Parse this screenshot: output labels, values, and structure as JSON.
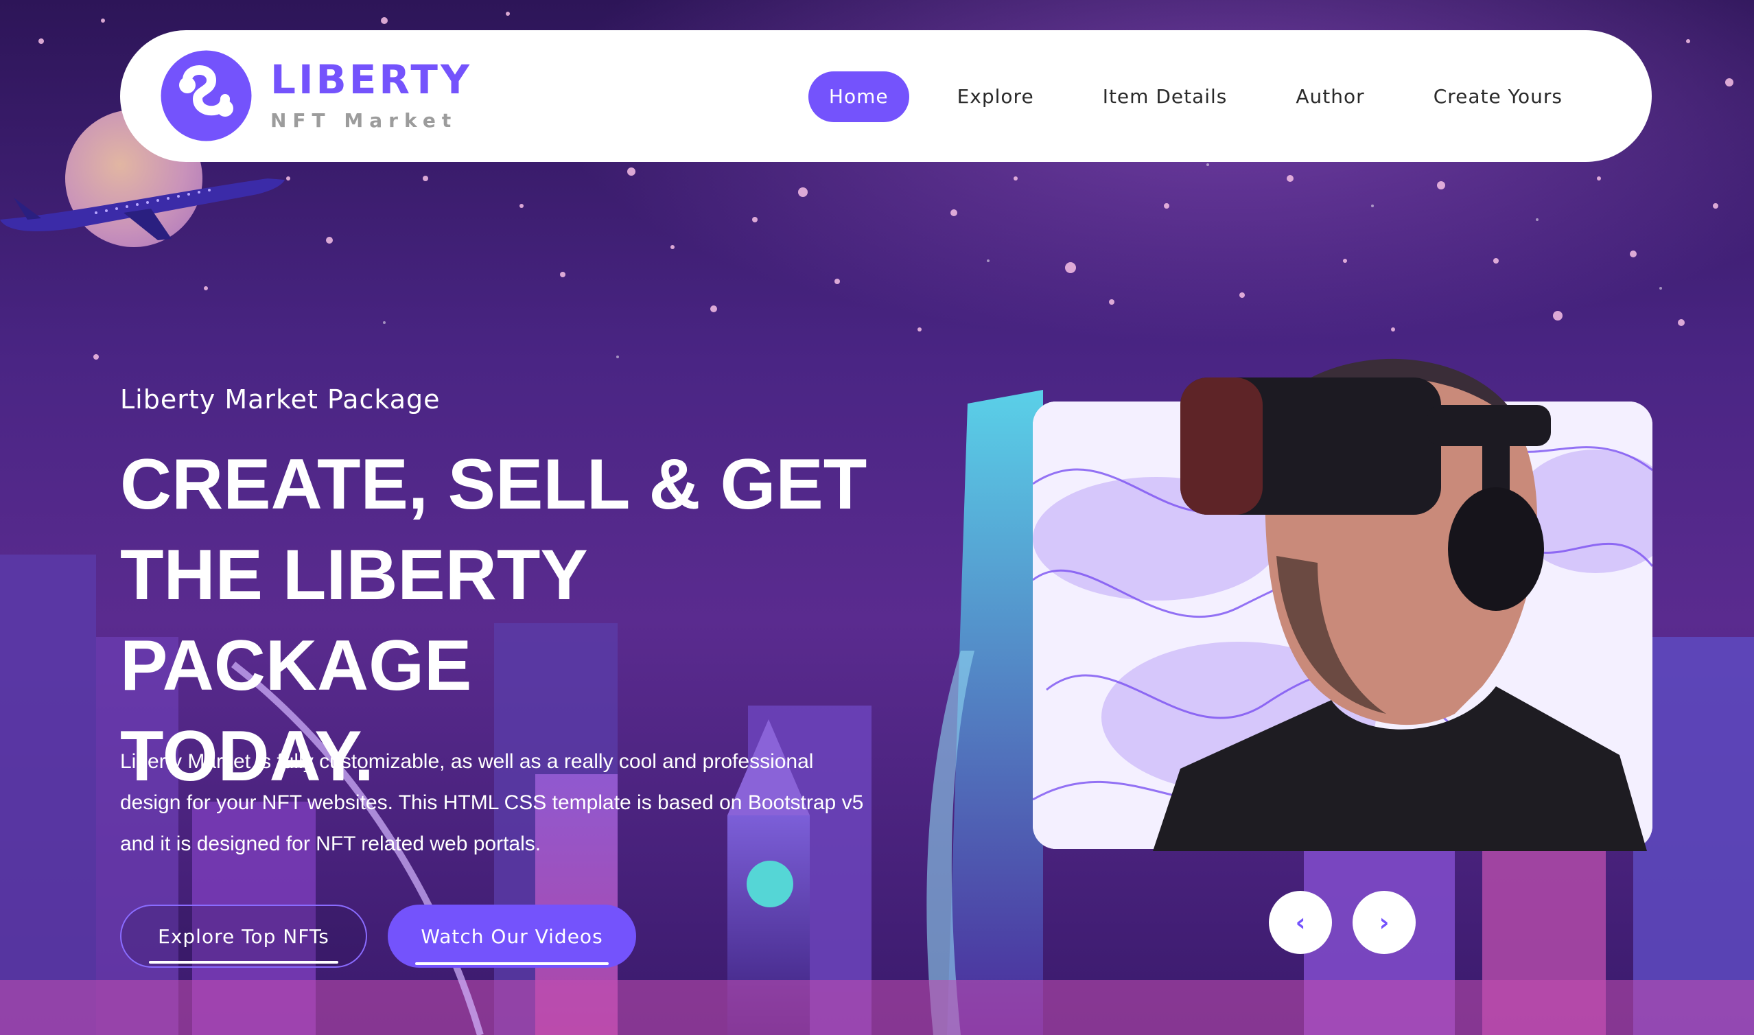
{
  "brand": {
    "name": "LIBERTY",
    "tagline": "NFT Market",
    "logo_icon": "liberty-swirl-logo-icon",
    "accent_color": "#7453fc"
  },
  "nav": {
    "items": [
      {
        "label": "Home",
        "active": true
      },
      {
        "label": "Explore",
        "active": false
      },
      {
        "label": "Item Details",
        "active": false
      },
      {
        "label": "Author",
        "active": false
      },
      {
        "label": "Create Yours",
        "active": false
      }
    ]
  },
  "hero": {
    "kicker": "Liberty Market Package",
    "title_line1": "CREATE, SELL & GET",
    "title_line2": "THE LIBERTY PACKAGE",
    "title_line3": "TODAY.",
    "description_line1": "Liberty Market is fully customizable, as well as a really cool and professional",
    "description_line2": "design for your NFT websites. This HTML CSS template is based on Bootstrap v5",
    "description_line3": "and it is designed for NFT related web portals.",
    "primary_button": "Explore Top NFTs",
    "secondary_button": "Watch Our Videos"
  },
  "carousel": {
    "prev_icon": "‹",
    "next_icon": "›"
  },
  "colors": {
    "background": "#3a1f66",
    "header_bg": "#ffffff",
    "nav_text": "#2a2a2a"
  }
}
